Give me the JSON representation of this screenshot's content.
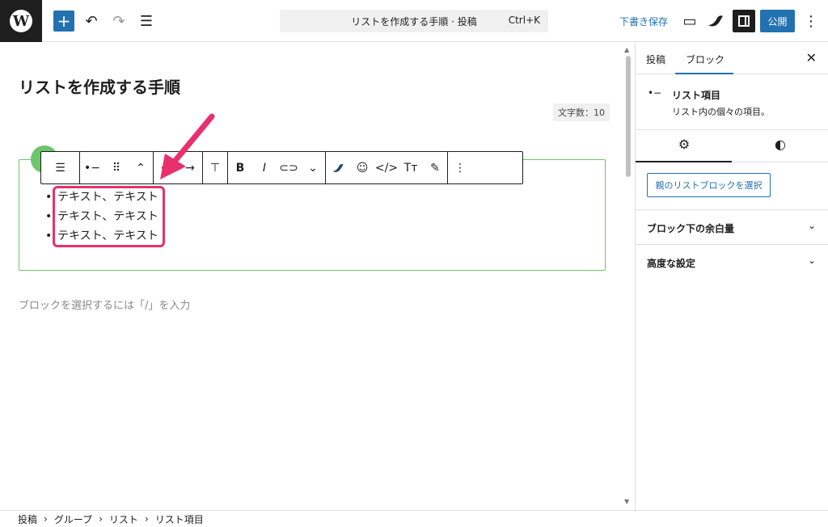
{
  "topbar": {
    "document_title": "リストを作成する手順 · 投稿",
    "shortcut": "Ctrl+K",
    "save_draft": "下書き保存",
    "publish": "公開"
  },
  "editor": {
    "post_title": "リストを作成する手順",
    "word_count": "文字数：10",
    "list_items": [
      "テキスト、テキスト",
      "テキスト、テキスト",
      "テキスト、テキスト"
    ],
    "placeholder": "ブロックを選択するには「/」を入力"
  },
  "sidebar": {
    "tabs": [
      "投稿",
      "ブロック"
    ],
    "block_name": "リスト項目",
    "block_desc": "リスト内の個々の項目。",
    "select_parent": "親のリストブロックを選択",
    "panels": [
      "ブロック下の余白量",
      "高度な設定"
    ]
  },
  "breadcrumb": [
    "投稿",
    "グループ",
    "リスト",
    "リスト項目"
  ],
  "colors": {
    "accent": "#2271b1",
    "highlight": "#e8306d",
    "block_border": "#6cc56a"
  }
}
